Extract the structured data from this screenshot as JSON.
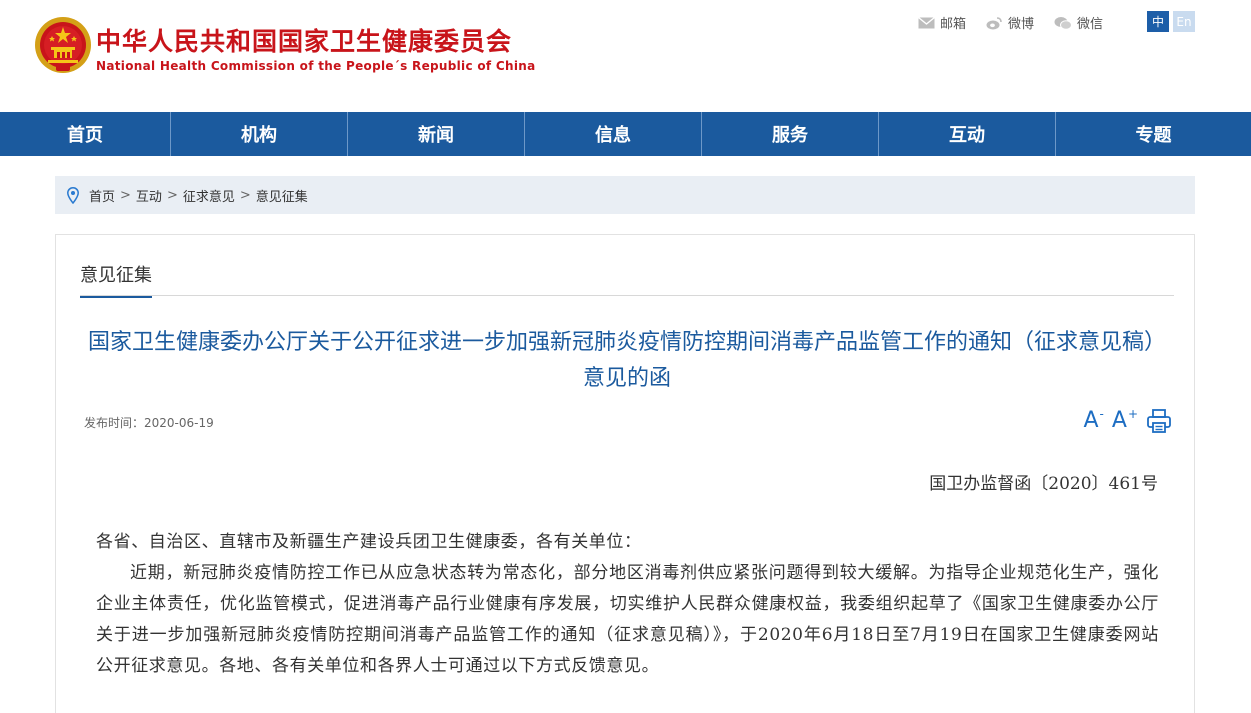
{
  "header": {
    "title": "中华人民共和国国家卫生健康委员会",
    "subtitle": "National Health Commission of the People´s Republic of China",
    "emblem_icon": "national-emblem-icon",
    "links": [
      {
        "label": "邮箱",
        "icon": "mail-icon"
      },
      {
        "label": "微博",
        "icon": "weibo-icon"
      },
      {
        "label": "微信",
        "icon": "wechat-icon"
      }
    ],
    "lang": {
      "zh": "中",
      "en": "En"
    }
  },
  "nav": {
    "items": [
      {
        "label": "首页"
      },
      {
        "label": "机构"
      },
      {
        "label": "新闻"
      },
      {
        "label": "信息"
      },
      {
        "label": "服务"
      },
      {
        "label": "互动"
      },
      {
        "label": "专题"
      }
    ]
  },
  "breadcrumb": {
    "items": [
      "首页",
      "互动",
      "征求意见",
      "意见征集"
    ],
    "separator": ">"
  },
  "section": {
    "title": "意见征集"
  },
  "article": {
    "title": "国家卫生健康委办公厅关于公开征求进一步加强新冠肺炎疫情防控期间消毒产品监管工作的通知（征求意见稿）意见的函",
    "date_label": "发布时间：",
    "date": "2020-06-19",
    "tools": {
      "decrease": "A",
      "increase": "A",
      "decrease_sign": "-",
      "increase_sign": "+"
    },
    "doc_number": "国卫办监督函〔2020〕461号",
    "salutation": "各省、自治区、直辖市及新疆生产建设兵团卫生健康委，各有关单位：",
    "paragraph": "近期，新冠肺炎疫情防控工作已从应急状态转为常态化，部分地区消毒剂供应紧张问题得到较大缓解。为指导企业规范化生产，强化企业主体责任，优化监管模式，促进消毒产品行业健康有序发展，切实维护人民群众健康权益，我委组织起草了《国家卫生健康委办公厅关于进一步加强新冠肺炎疫情防控期间消毒产品监管工作的通知（征求意见稿）》，于2020年6月18日至7月19日在国家卫生健康委网站公开征求意见。各地、各有关单位和各界人士可通过以下方式反馈意见。"
  },
  "colors": {
    "brand_red": "#c8141a",
    "nav_blue": "#1b5a9e",
    "title_blue": "#1b5a9e",
    "breadcrumb_bg": "#e9eef4"
  }
}
